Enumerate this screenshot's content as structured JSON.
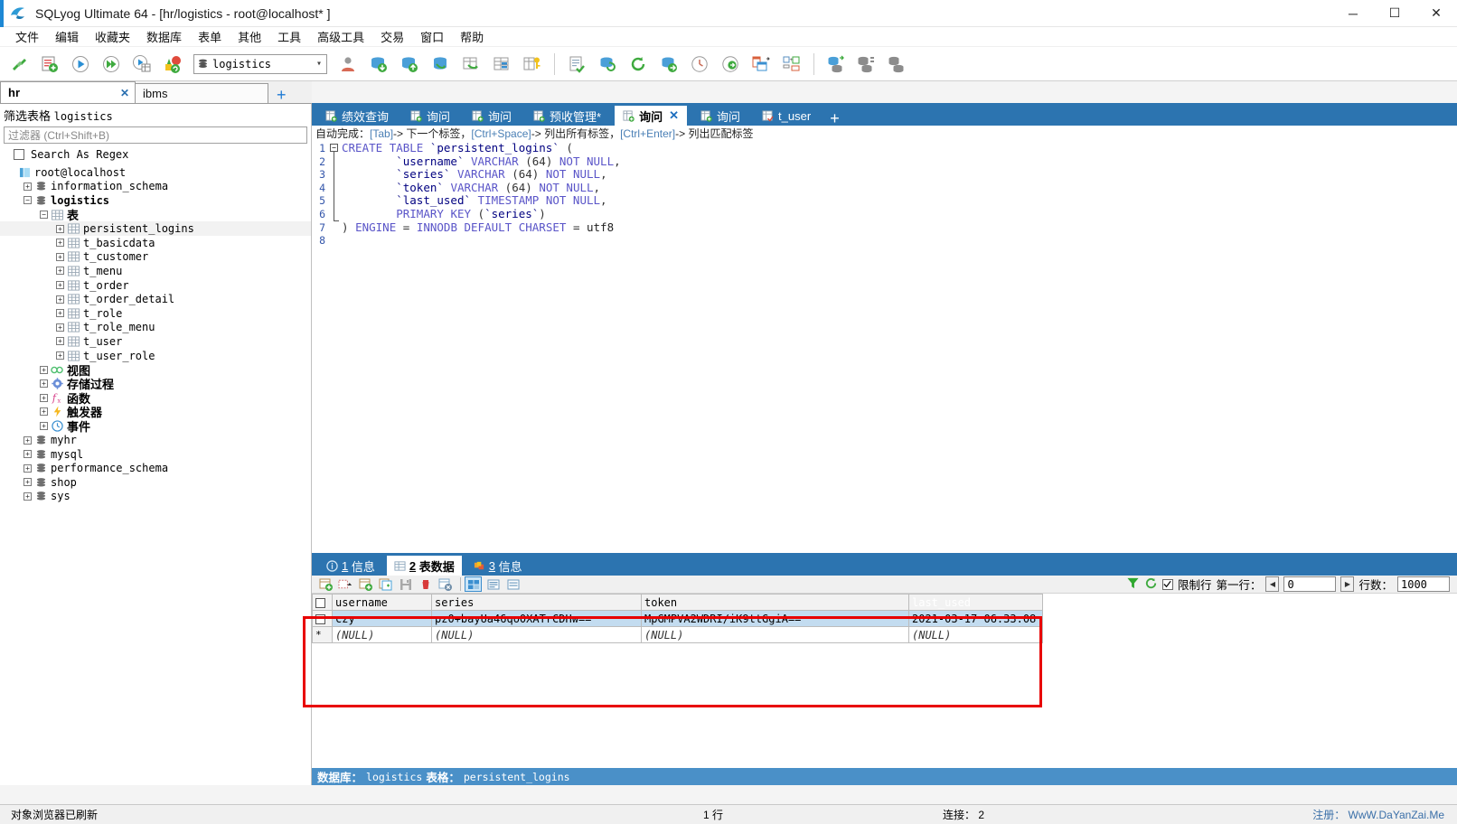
{
  "window": {
    "title": "SQLyog Ultimate 64 - [hr/logistics - root@localhost* ]",
    "minimize": "─",
    "maximize": "☐",
    "close": "✕",
    "app_icon": "sqlyog-dolphin-icon"
  },
  "menubar": {
    "items": [
      {
        "label": "文件"
      },
      {
        "label": "编辑"
      },
      {
        "label": "收藏夹"
      },
      {
        "label": "数据库"
      },
      {
        "label": "表单"
      },
      {
        "label": "其他"
      },
      {
        "label": "工具"
      },
      {
        "label": "高级工具"
      },
      {
        "label": "交易"
      },
      {
        "label": "窗口"
      },
      {
        "label": "帮助"
      }
    ]
  },
  "toolbar": {
    "db_selector_value": "logistics",
    "buttons": [
      "new-connection-icon",
      "new-query-editor-icon",
      "execute-query-icon",
      "execute-all-queries-icon",
      "execute-query-to-grid-icon",
      "refresh-objects-icon"
    ],
    "buttons2": [
      "user-manager-icon",
      "import-database-icon",
      "export-database-icon",
      "backup-database-icon",
      "restore-database-icon",
      "import-table-icon",
      "table-diagnostics-icon",
      "schema-designer-icon"
    ],
    "buttons3": [
      "query-builder-icon",
      "sync-database-icon",
      "refresh-icon",
      "migrate-database-icon",
      "scheduled-backup-icon",
      "notifications-icon",
      "compare-schema-icon",
      "form-view-icon"
    ],
    "buttons4": [
      "database-sync-icon",
      "data-sync-icon",
      "copy-database-icon"
    ]
  },
  "connection_tabs": {
    "tabs": [
      {
        "label": "hr",
        "active": true,
        "close": "✕"
      },
      {
        "label": "ibms",
        "active": false
      }
    ],
    "add_label": "+"
  },
  "sidebar": {
    "filter_title_prefix": "筛选表格",
    "filter_title_db": "logistics",
    "filter_placeholder": "过滤器 (Ctrl+Shift+B)",
    "search_as_regex_label": "Search As Regex",
    "search_as_regex_checked": false,
    "tree": [
      {
        "label": "root@localhost",
        "indent": 0,
        "icon": "host-icon",
        "expander": "",
        "bold": false,
        "cjk": false
      },
      {
        "label": "information_schema",
        "indent": 1,
        "icon": "database-icon",
        "expander": "+",
        "bold": false,
        "cjk": false
      },
      {
        "label": "logistics",
        "indent": 1,
        "icon": "database-icon",
        "expander": "-",
        "bold": true,
        "cjk": false
      },
      {
        "label": "表",
        "indent": 2,
        "icon": "tables-folder-icon",
        "expander": "-",
        "bold": true,
        "cjk": true
      },
      {
        "label": "persistent_logins",
        "indent": 3,
        "icon": "table-icon",
        "expander": "+",
        "bold": false,
        "cjk": false,
        "selected": true
      },
      {
        "label": "t_basicdata",
        "indent": 3,
        "icon": "table-icon",
        "expander": "+",
        "bold": false,
        "cjk": false
      },
      {
        "label": "t_customer",
        "indent": 3,
        "icon": "table-icon",
        "expander": "+",
        "bold": false,
        "cjk": false
      },
      {
        "label": "t_menu",
        "indent": 3,
        "icon": "table-icon",
        "expander": "+",
        "bold": false,
        "cjk": false
      },
      {
        "label": "t_order",
        "indent": 3,
        "icon": "table-icon",
        "expander": "+",
        "bold": false,
        "cjk": false
      },
      {
        "label": "t_order_detail",
        "indent": 3,
        "icon": "table-icon",
        "expander": "+",
        "bold": false,
        "cjk": false
      },
      {
        "label": "t_role",
        "indent": 3,
        "icon": "table-icon",
        "expander": "+",
        "bold": false,
        "cjk": false
      },
      {
        "label": "t_role_menu",
        "indent": 3,
        "icon": "table-icon",
        "expander": "+",
        "bold": false,
        "cjk": false
      },
      {
        "label": "t_user",
        "indent": 3,
        "icon": "table-icon",
        "expander": "+",
        "bold": false,
        "cjk": false
      },
      {
        "label": "t_user_role",
        "indent": 3,
        "icon": "table-icon",
        "expander": "+",
        "bold": false,
        "cjk": false
      },
      {
        "label": "视图",
        "indent": 2,
        "icon": "views-icon",
        "expander": "+",
        "bold": true,
        "cjk": true
      },
      {
        "label": "存储过程",
        "indent": 2,
        "icon": "stored-procedures-icon",
        "expander": "+",
        "bold": true,
        "cjk": true
      },
      {
        "label": "函数",
        "indent": 2,
        "icon": "functions-icon",
        "expander": "+",
        "bold": true,
        "cjk": true
      },
      {
        "label": "触发器",
        "indent": 2,
        "icon": "triggers-icon",
        "expander": "+",
        "bold": true,
        "cjk": true
      },
      {
        "label": "事件",
        "indent": 2,
        "icon": "events-icon",
        "expander": "+",
        "bold": true,
        "cjk": true
      },
      {
        "label": "myhr",
        "indent": 1,
        "icon": "database-icon",
        "expander": "+",
        "bold": false,
        "cjk": false
      },
      {
        "label": "mysql",
        "indent": 1,
        "icon": "database-icon",
        "expander": "+",
        "bold": false,
        "cjk": false
      },
      {
        "label": "performance_schema",
        "indent": 1,
        "icon": "database-icon",
        "expander": "+",
        "bold": false,
        "cjk": false
      },
      {
        "label": "shop",
        "indent": 1,
        "icon": "database-icon",
        "expander": "+",
        "bold": false,
        "cjk": false
      },
      {
        "label": "sys",
        "indent": 1,
        "icon": "database-icon",
        "expander": "+",
        "bold": false,
        "cjk": false
      }
    ]
  },
  "editor": {
    "tabs": [
      {
        "label": "绩效查询",
        "active": false,
        "icon": "query-tab-icon"
      },
      {
        "label": "询问",
        "active": false,
        "icon": "query-tab-icon"
      },
      {
        "label": "询问",
        "active": false,
        "icon": "query-tab-icon"
      },
      {
        "label": "预收管理*",
        "active": false,
        "icon": "query-tab-icon"
      },
      {
        "label": "询问",
        "active": true,
        "icon": "query-tab-icon",
        "close": "✕"
      },
      {
        "label": "询问",
        "active": false,
        "icon": "query-tab-icon"
      },
      {
        "label": "t_user",
        "active": false,
        "icon": "table-data-tab-icon"
      }
    ],
    "add_label": "+",
    "autocomplete_hint": {
      "prefix": "自动完成：",
      "part1_key": "[Tab]",
      "part1_text": "-> 下一个标签，",
      "part2_key": "[Ctrl+Space]",
      "part2_text": "-> 列出所有标签，",
      "part3_key": "[Ctrl+Enter]",
      "part3_text": "-> 列出匹配标签"
    },
    "line_numbers": [
      "1",
      "2",
      "3",
      "4",
      "5",
      "6",
      "7",
      "8"
    ],
    "sql_lines": [
      "CREATE TABLE `persistent_logins` (",
      "        `username` VARCHAR (64) NOT NULL,",
      "        `series` VARCHAR (64) NOT NULL,",
      "        `token` VARCHAR (64) NOT NULL,",
      "        `last_used` TIMESTAMP NOT NULL,",
      "        PRIMARY KEY (`series`)",
      ") ENGINE = INNODB DEFAULT CHARSET = utf8",
      ""
    ]
  },
  "results": {
    "tabs": [
      {
        "num": "1",
        "label": "信息",
        "active": false,
        "icon": "info-tab-icon"
      },
      {
        "num": "2",
        "label": "表数据",
        "active": true,
        "icon": "table-data-tab-icon"
      },
      {
        "num": "3",
        "label": "信息",
        "active": false,
        "icon": "messages-tab-icon"
      }
    ],
    "grid_toolbar": {
      "buttons": [
        "refresh-data-icon",
        "filter-data-icon",
        "insert-row-icon",
        "duplicate-row-icon",
        "save-changes-icon",
        "delete-row-icon",
        "cancel-changes-icon"
      ],
      "view_buttons": [
        "grid-view-icon",
        "form-view-icon",
        "text-view-icon"
      ],
      "filter_icon": "funnel-icon",
      "refresh_icon": "refresh-green-icon",
      "limit_rows_label": "限制行",
      "limit_rows_checked": true,
      "first_row_label": "第一行：",
      "first_row_value": "0",
      "row_count_label": "行数：",
      "row_count_value": "1000",
      "spin_prev": "◀",
      "spin_next": "▶"
    },
    "columns": [
      "username",
      "series",
      "token",
      "last_used"
    ],
    "selected_column": "last_used",
    "rows": [
      {
        "marker": "",
        "selected": true,
        "cells": [
          "czy",
          "pz0+bayUa46qo0XATrCDHw==",
          "MpGMPVA2WDRI/iK9ttGgiA==",
          "2021-03-17 06:33:08"
        ]
      },
      {
        "marker": "*",
        "selected": false,
        "cells": [
          "(NULL)",
          "(NULL)",
          "(NULL)",
          "(NULL)"
        ]
      }
    ],
    "status": {
      "db_label": "数据库：",
      "db_value": "logistics",
      "table_label": "表格：",
      "table_value": "persistent_logins"
    }
  },
  "statusbar": {
    "left": "对象浏览器已刷新",
    "rows": "1 行",
    "connection": "连接： 2",
    "right": "注册： WwW.DaYanZai.Me"
  },
  "colors": {
    "accent_blue": "#2c74b0",
    "grid_header_sel": "#2f8ed6",
    "row_select": "#c3dcf0",
    "red_highlight": "#e80000",
    "status_blue": "#4a90c8"
  }
}
